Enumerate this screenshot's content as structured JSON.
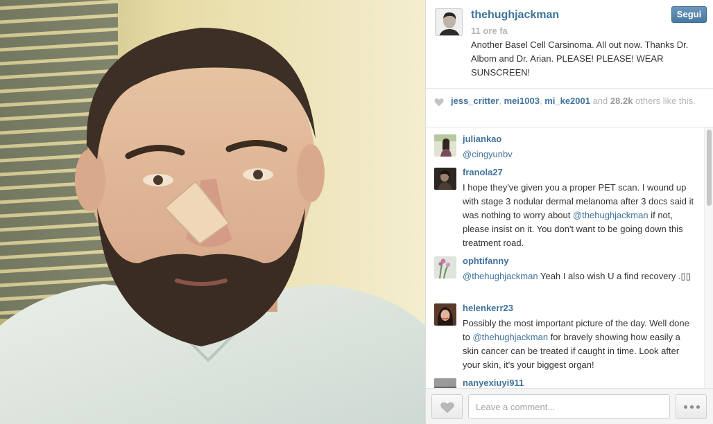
{
  "post": {
    "owner": "thehughjackman",
    "time": "11 ore fa",
    "follow_label": "Segui",
    "caption": "Another Basel Cell Carsinoma. All out now. Thanks Dr. Albom and Dr. Arian. PLEASE! PLEASE! WEAR SUNSCREEN!"
  },
  "likes": {
    "users": [
      "jess_critter",
      "mei1003",
      "mi_ke2001"
    ],
    "sep": ", ",
    "and": " and ",
    "count": "28.2k",
    "suffix": " others like this."
  },
  "comments": [
    {
      "user": "juliankao",
      "mention": "@cingyunbv",
      "text": ""
    },
    {
      "user": "franola27",
      "text_before": "I hope they've given you a proper PET scan. I wound up with stage 3 nodular dermal melanoma after 3 docs said it was nothing to worry about ",
      "mention": "@thehughjackman",
      "text_after": " if not, please insist on it. You don't want to be going down this treatment road."
    },
    {
      "user": "ophtifanny",
      "mention": "@thehughjackman",
      "text_after": " Yeah I also wish U a find recovery .▯▯"
    },
    {
      "user": "helenkerr23",
      "text_before": "Possibly the most important picture of the day. Well done to ",
      "mention": "@thehughjackman",
      "text_after": " for bravely showing how easily a skin cancer can be treated if caught in time. Look after your skin, it's your biggest organ!"
    },
    {
      "user": "nanyexiuyi911"
    }
  ],
  "footer": {
    "comment_placeholder": "Leave a comment..."
  },
  "icons": {
    "like": "heart-icon",
    "more": "ellipsis-icon"
  },
  "colors": {
    "link": "#3f729b",
    "follow_button": "#517fa4"
  }
}
